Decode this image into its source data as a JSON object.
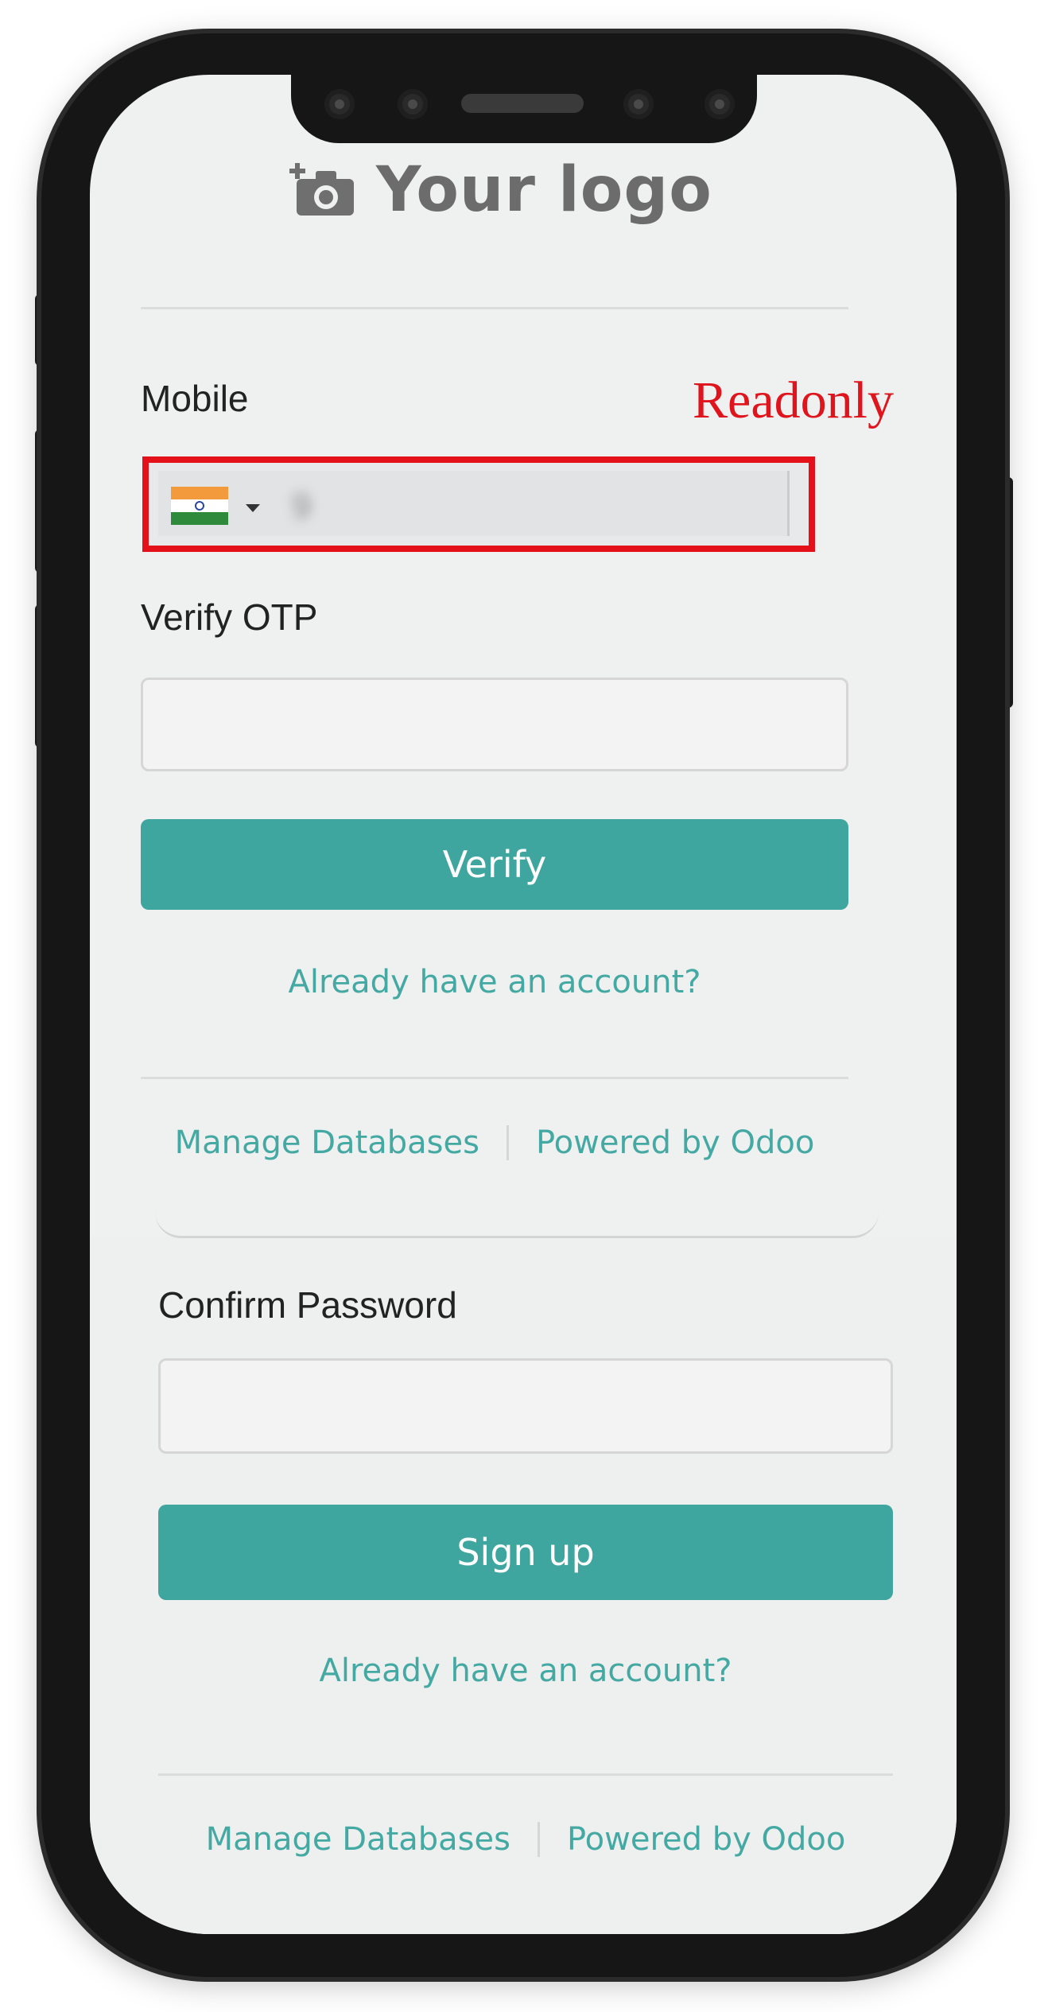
{
  "logo": {
    "icon": "camera-plus-icon",
    "text": "Your logo"
  },
  "annotation": {
    "readonly_label": "Readonly",
    "color": "#e0141c"
  },
  "signup_form": {
    "mobile": {
      "label": "Mobile",
      "country_flag": "india-flag-icon",
      "value": "9"
    },
    "verify_otp": {
      "label": "Verify OTP",
      "value": ""
    },
    "verify_button": "Verify",
    "already_account_link": "Already have an account?"
  },
  "footer_top": {
    "manage_databases": "Manage Databases",
    "powered_by": "Powered by Odoo"
  },
  "lower_form": {
    "confirm_password": {
      "label": "Confirm Password",
      "value": ""
    },
    "signup_button": "Sign up",
    "already_account_link": "Already have an account?"
  },
  "footer_bottom": {
    "manage_databases": "Manage Databases",
    "powered_by": "Powered by Odoo"
  },
  "colors": {
    "accent": "#3fa59f",
    "link": "#45a9a3",
    "highlight_border": "#e4111b"
  }
}
